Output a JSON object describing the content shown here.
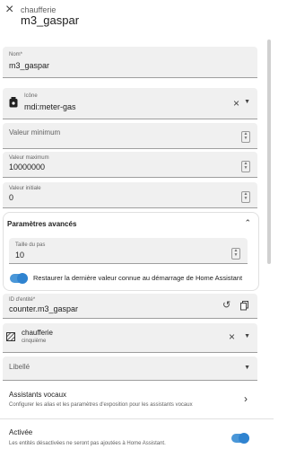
{
  "header": {
    "subtitle": "chaufferie",
    "title": "m3_gaspar"
  },
  "fields": {
    "nom": {
      "label": "Nom*",
      "value": "m3_gaspar"
    },
    "icone": {
      "label": "Icône",
      "value": "mdi:meter-gas"
    },
    "min": {
      "placeholder": "Valeur minimum"
    },
    "max": {
      "label": "Valeur maximum",
      "value": "10000000"
    },
    "initial": {
      "label": "Valeur initiale",
      "value": "0"
    }
  },
  "advanced": {
    "title": "Paramètres avancés",
    "step": {
      "label": "Taille du pas",
      "value": "10"
    },
    "restore_label": "Restaurer la dernière valeur connue au démarrage de Home Assistant"
  },
  "entity": {
    "label": "ID d'entité*",
    "value": "counter.m3_gaspar"
  },
  "area": {
    "name": "chaufferie",
    "floor": "cinquième"
  },
  "labels": {
    "placeholder": "Libellé"
  },
  "voice": {
    "title": "Assistants vocaux",
    "description": "Configurer les alias et les paramètres d'exposition pour les assistants vocaux"
  },
  "enabled": {
    "title": "Activée",
    "description": "Les entités désactivées ne seront pas ajoutées à Home Assistant."
  },
  "colors": {
    "toggle": "#2f83d0",
    "field_bg": "#f0f0f0"
  }
}
